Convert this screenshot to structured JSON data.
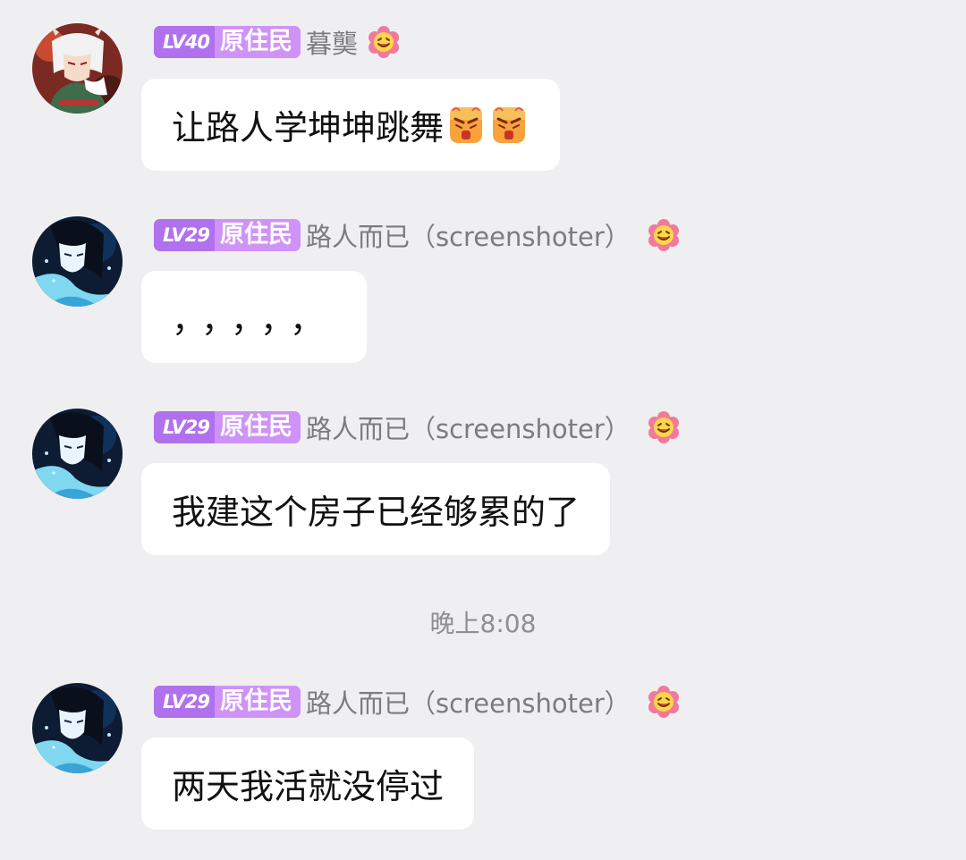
{
  "messages": [
    {
      "level": "LV40",
      "title": "原住民",
      "nickname": "暮龑",
      "text": "让路人学坤坤跳舞",
      "emojis": [
        "angry-face-emoji",
        "angry-face-emoji"
      ],
      "avatar": "anime-avatar-white-hair-icon"
    },
    {
      "level": "LV29",
      "title": "原住民",
      "nickname": "路人而已（screenshoter）",
      "text": "，，，，，",
      "avatar": "anime-avatar-dark-hair-icon"
    },
    {
      "level": "LV29",
      "title": "原住民",
      "nickname": "路人而已（screenshoter）",
      "text": "我建这个房子已经够累的了",
      "avatar": "anime-avatar-dark-hair-icon"
    },
    {
      "level": "LV29",
      "title": "原住民",
      "nickname": "路人而已（screenshoter）",
      "text": "两天我活就没停过",
      "avatar": "anime-avatar-dark-hair-icon"
    }
  ],
  "timestamp": "晚上8:08",
  "colors": {
    "background": "#efeff1",
    "badge": "#c98af6",
    "bubble": "#ffffff",
    "nickname": "#7c7c80"
  }
}
